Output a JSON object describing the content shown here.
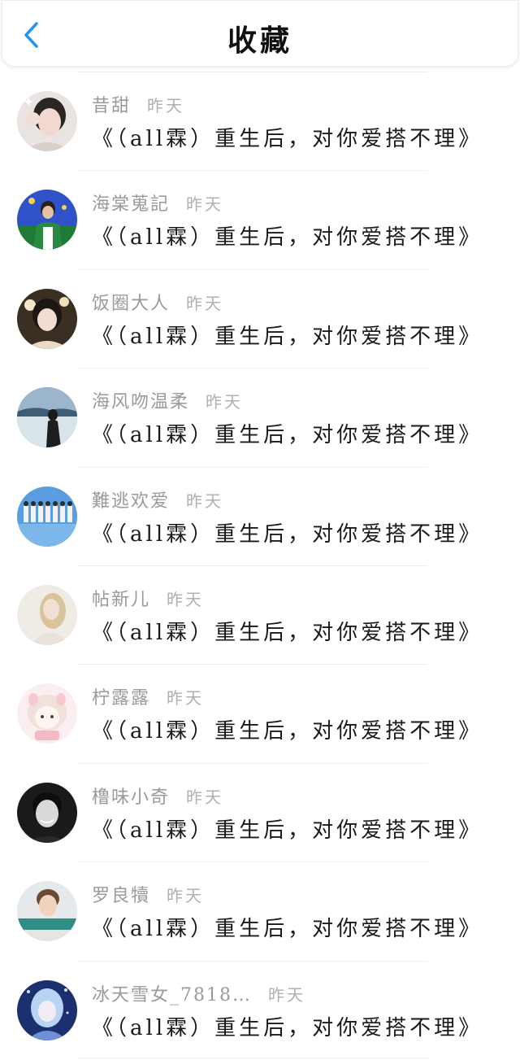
{
  "header": {
    "title": "收藏",
    "back_icon": "chevron-left-icon",
    "accent_color": "#2196f3"
  },
  "items": [
    {
      "username": "昔甜",
      "time": "昨天",
      "title": "《（all霖）重生后，对你爱搭不理》",
      "avatar": "avatar-girl-ok-hand"
    },
    {
      "username": "海棠蒐記",
      "time": "昨天",
      "title": "《（all霖）重生后，对你爱搭不理》",
      "avatar": "avatar-boy-green-stage"
    },
    {
      "username": "饭圈大人",
      "time": "昨天",
      "title": "《（all霖）重生后，对你爱搭不理》",
      "avatar": "avatar-girl-flowers"
    },
    {
      "username": "海风吻温柔",
      "time": "昨天",
      "title": "《（all霖）重生后，对你爱搭不理》",
      "avatar": "avatar-girl-sea"
    },
    {
      "username": "難逃欢爱",
      "time": "昨天",
      "title": "《（all霖）重生后，对你爱搭不理》",
      "avatar": "avatar-group-blue"
    },
    {
      "username": "帖新儿",
      "time": "昨天",
      "title": "《（all霖）重生后，对你爱搭不理》",
      "avatar": "avatar-woman-blonde"
    },
    {
      "username": "柠露露",
      "time": "昨天",
      "title": "《（all霖）重生后，对你爱搭不理》",
      "avatar": "avatar-anime-pink"
    },
    {
      "username": "橹味小奇",
      "time": "昨天",
      "title": "《（all霖）重生后，对你爱搭不理》",
      "avatar": "avatar-boy-bw"
    },
    {
      "username": "罗良犢",
      "time": "昨天",
      "title": "《（all霖）重生后，对你爱搭不理》",
      "avatar": "avatar-boy-teal-banner"
    },
    {
      "username": "冰天雪女_7818…",
      "time": "昨天",
      "title": "《（all霖）重生后，对你爱搭不理》",
      "avatar": "avatar-anime-ice"
    }
  ]
}
